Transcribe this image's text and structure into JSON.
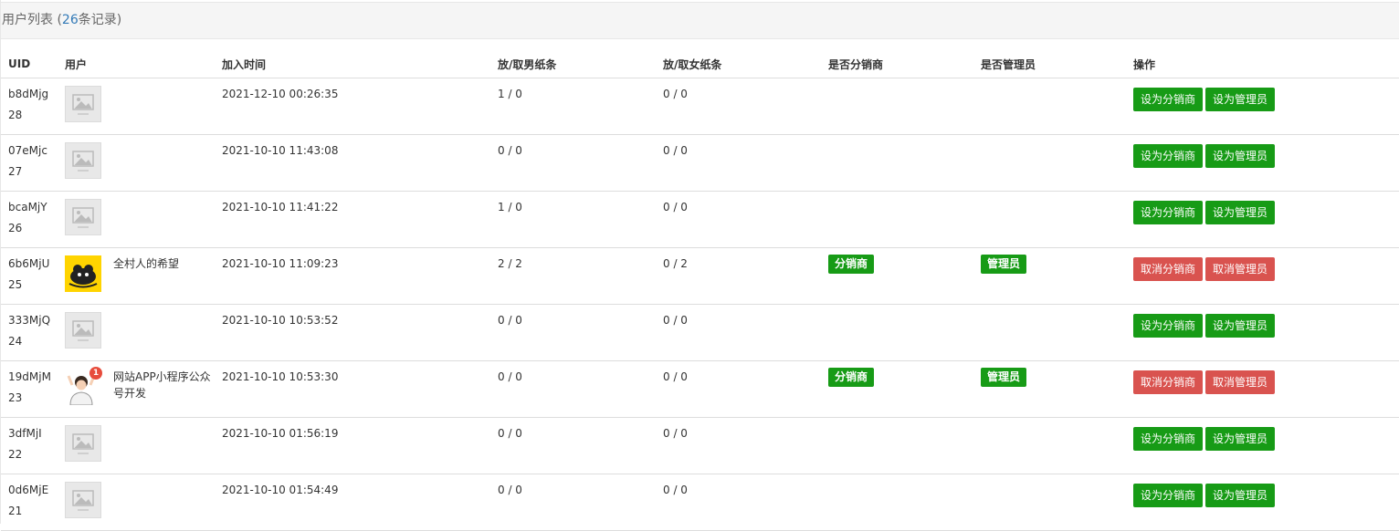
{
  "header": {
    "title": "用户列表",
    "count_prefix": "(",
    "count": "26",
    "count_suffix": "条记录)"
  },
  "columns": [
    "UID",
    "用户",
    "加入时间",
    "放/取男纸条",
    "放/取女纸条",
    "是否分销商",
    "是否管理员",
    "操作"
  ],
  "rows": [
    {
      "uid_code": "b8dMjg",
      "uid_num": "28",
      "avatar": "placeholder",
      "nickname": "",
      "badge": "",
      "joined": "2021-12-10 00:26:35",
      "male_notes": "1 / 0",
      "female_notes": "0 / 0",
      "distributor": "",
      "admin": "",
      "btn1": "设为分销商",
      "btn1_color": "#179b16",
      "btn2": "设为管理员",
      "btn2_color": "#179b16"
    },
    {
      "uid_code": "07eMjc",
      "uid_num": "27",
      "avatar": "placeholder",
      "nickname": "",
      "badge": "",
      "joined": "2021-10-10 11:43:08",
      "male_notes": "0 / 0",
      "female_notes": "0 / 0",
      "distributor": "",
      "admin": "",
      "btn1": "设为分销商",
      "btn1_color": "#179b16",
      "btn2": "设为管理员",
      "btn2_color": "#179b16"
    },
    {
      "uid_code": "bcaMjY",
      "uid_num": "26",
      "avatar": "placeholder",
      "nickname": "",
      "badge": "",
      "joined": "2021-10-10 11:41:22",
      "male_notes": "1 / 0",
      "female_notes": "0 / 0",
      "distributor": "",
      "admin": "",
      "btn1": "设为分销商",
      "btn1_color": "#179b16",
      "btn2": "设为管理员",
      "btn2_color": "#179b16"
    },
    {
      "uid_code": "6b6MjU",
      "uid_num": "25",
      "avatar": "yellow",
      "nickname": "全村人的希望",
      "badge": "",
      "joined": "2021-10-10 11:09:23",
      "male_notes": "2 / 2",
      "female_notes": "0 / 2",
      "distributor": "分销商",
      "admin": "管理员",
      "btn1": "取消分销商",
      "btn1_color": "#d9534f",
      "btn2": "取消管理员",
      "btn2_color": "#d9534f"
    },
    {
      "uid_code": "333MjQ",
      "uid_num": "24",
      "avatar": "placeholder",
      "nickname": "",
      "badge": "",
      "joined": "2021-10-10 10:53:52",
      "male_notes": "0 / 0",
      "female_notes": "0 / 0",
      "distributor": "",
      "admin": "",
      "btn1": "设为分销商",
      "btn1_color": "#179b16",
      "btn2": "设为管理员",
      "btn2_color": "#179b16"
    },
    {
      "uid_code": "19dMjM",
      "uid_num": "23",
      "avatar": "person",
      "nickname": "网站APP小程序公众号开发",
      "badge": "1",
      "joined": "2021-10-10 10:53:30",
      "male_notes": "0 / 0",
      "female_notes": "0 / 0",
      "distributor": "分销商",
      "admin": "管理员",
      "btn1": "取消分销商",
      "btn1_color": "#d9534f",
      "btn2": "取消管理员",
      "btn2_color": "#d9534f"
    },
    {
      "uid_code": "3dfMjI",
      "uid_num": "22",
      "avatar": "placeholder",
      "nickname": "",
      "badge": "",
      "joined": "2021-10-10 01:56:19",
      "male_notes": "0 / 0",
      "female_notes": "0 / 0",
      "distributor": "",
      "admin": "",
      "btn1": "设为分销商",
      "btn1_color": "#179b16",
      "btn2": "设为管理员",
      "btn2_color": "#179b16"
    },
    {
      "uid_code": "0d6MjE",
      "uid_num": "21",
      "avatar": "placeholder",
      "nickname": "",
      "badge": "",
      "joined": "2021-10-10 01:54:49",
      "male_notes": "0 / 0",
      "female_notes": "0 / 0",
      "distributor": "",
      "admin": "",
      "btn1": "设为分销商",
      "btn1_color": "#179b16",
      "btn2": "设为管理员",
      "btn2_color": "#179b16"
    }
  ]
}
